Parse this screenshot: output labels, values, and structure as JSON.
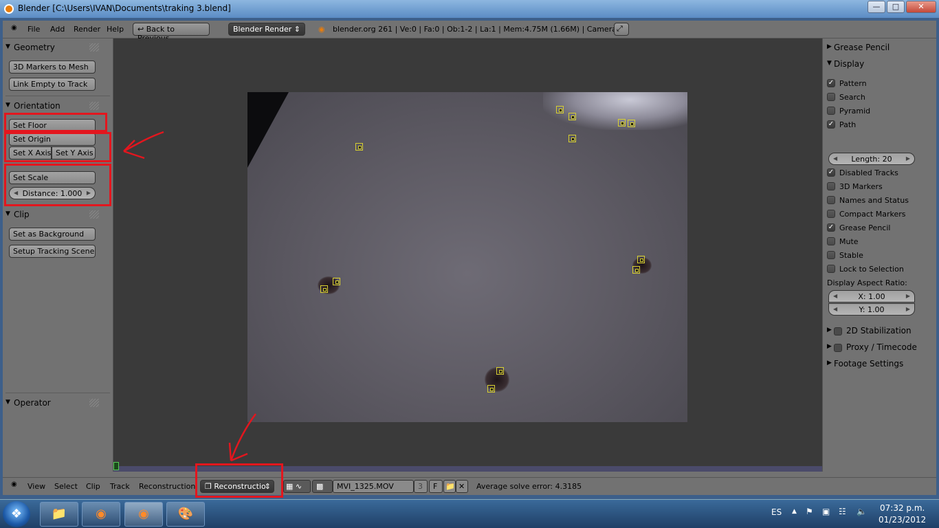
{
  "window": {
    "title": "Blender  [C:\\Users\\IVAN\\Documents\\traking 3.blend]",
    "buttons": [
      "minimize",
      "maximize",
      "close"
    ]
  },
  "info_header": {
    "menus": [
      "File",
      "Add",
      "Render",
      "Help"
    ],
    "back_button": "Back to Previous",
    "render_engine": "Blender Render",
    "stats": "blender.org 261 | Ve:0 | Fa:0 | Ob:1-2 | La:1 | Mem:4.75M (1.66M) | Camera"
  },
  "toolshelf": {
    "geometry": {
      "title": "Geometry",
      "buttons": [
        "3D Markers to Mesh",
        "Link Empty to Track"
      ]
    },
    "orientation": {
      "title": "Orientation",
      "set_floor": "Set Floor",
      "set_origin": "Set Origin",
      "set_x_axis": "Set X Axis",
      "set_y_axis": "Set Y Axis",
      "set_scale": "Set Scale",
      "distance": "Distance: 1.000"
    },
    "clip": {
      "title": "Clip",
      "buttons": [
        "Set as Background",
        "Setup Tracking Scene"
      ]
    },
    "operator": {
      "title": "Operator"
    }
  },
  "properties": {
    "grease_pencil": "Grease Pencil",
    "display": {
      "title": "Display",
      "options": [
        {
          "label": "Pattern",
          "checked": true
        },
        {
          "label": "Search",
          "checked": false
        },
        {
          "label": "Pyramid",
          "checked": false
        },
        {
          "label": "Path",
          "checked": true
        }
      ],
      "length": "Length: 20",
      "options2": [
        {
          "label": "Disabled Tracks",
          "checked": true
        },
        {
          "label": "3D Markers",
          "checked": false
        },
        {
          "label": "Names and Status",
          "checked": false
        },
        {
          "label": "Compact Markers",
          "checked": false
        },
        {
          "label": "Grease Pencil",
          "checked": true
        },
        {
          "label": "Mute",
          "checked": false
        },
        {
          "label": "Stable",
          "checked": false
        },
        {
          "label": "Lock to Selection",
          "checked": false
        }
      ],
      "aspect_label": "Display Aspect Ratio:",
      "aspect_x": "X: 1.00",
      "aspect_y": "Y: 1.00"
    },
    "stabilization": "2D Stabilization",
    "proxy": "Proxy / Timecode",
    "footage": "Footage Settings"
  },
  "bottom_header": {
    "menus": [
      "View",
      "Select",
      "Clip",
      "Track",
      "Reconstruction"
    ],
    "mode": "Reconstructio",
    "clip_name": "MVI_1325.MOV",
    "users": "3",
    "fake_user": "F",
    "solve_error": "Average solve error: 4.3185"
  },
  "taskbar": {
    "language": "ES",
    "time": "07:32 p.m.",
    "date": "01/23/2012"
  },
  "colors": {
    "annotation_red": "#e3161e",
    "marker_yellow": "#d8d030",
    "panel_gray": "#727272"
  }
}
